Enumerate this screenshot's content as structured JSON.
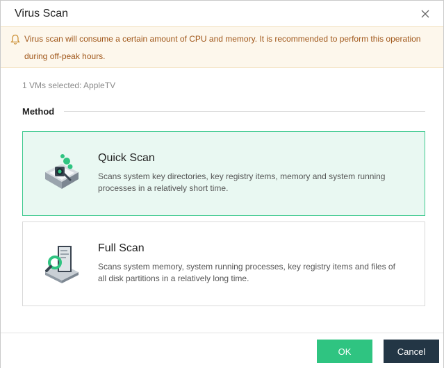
{
  "dialog": {
    "title": "Virus Scan",
    "close_icon": "close-icon"
  },
  "warning": {
    "icon": "bell-icon",
    "text": "Virus scan will consume a certain amount of CPU and memory. It is recommended to perform this operation during off-peak hours."
  },
  "selection": {
    "text": "1 VMs selected: AppleTV"
  },
  "method": {
    "label": "Method",
    "options": [
      {
        "title": "Quick Scan",
        "description": "Scans system key directories, key registry items, memory and system running processes in a relatively short time.",
        "selected": true,
        "icon": "quick-scan-icon"
      },
      {
        "title": "Full Scan",
        "description": "Scans system memory, system running processes, key registry items and files of all disk partitions in a relatively long time.",
        "selected": false,
        "icon": "full-scan-icon"
      }
    ]
  },
  "footer": {
    "ok_label": "OK",
    "cancel_label": "Cancel"
  },
  "colors": {
    "accent": "#2fc481",
    "selected_bg": "#e9f8f2",
    "cancel_bg": "#233645",
    "warning_text": "#a0571a"
  }
}
